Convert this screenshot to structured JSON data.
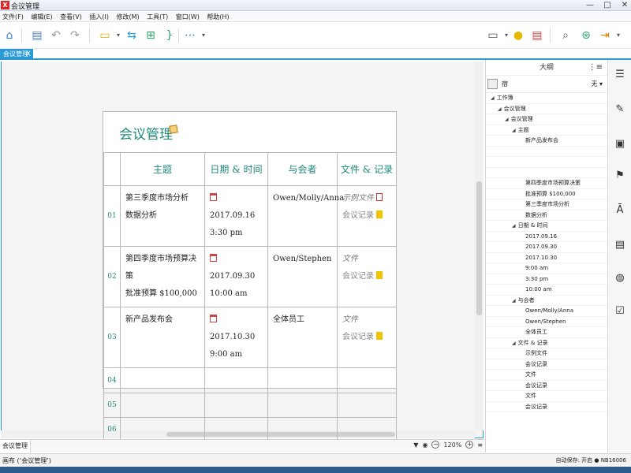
{
  "window": {
    "title": "会议管理",
    "app_icon": "x-logo",
    "controls": [
      "—",
      "□",
      "✕"
    ]
  },
  "menu": [
    "文件(F)",
    "编辑(E)",
    "查看(V)",
    "插入(I)",
    "修改(M)",
    "工具(T)",
    "窗口(W)",
    "帮助(H)"
  ],
  "document_tab": {
    "label": "会议管理",
    "close": "X"
  },
  "doc": {
    "title": "会议管理",
    "headers": [
      "主题",
      "日期 & 时间",
      "与会者",
      "文件 & 记录"
    ],
    "rows": [
      {
        "num": "01",
        "topic_line1": "第三季度市场分析",
        "topic_line2": "数据分析",
        "date": "2017.09.16",
        "time": "3:30 pm",
        "attendees": "Owen/Molly/Anna",
        "file1": "示例文件",
        "file2": "会议记录"
      },
      {
        "num": "02",
        "topic_line1": "第四季度市场预算决策",
        "topic_line2": "批准预算 $100,000",
        "date": "2017.09.30",
        "time": "10:00 am",
        "attendees": "Owen/Stephen",
        "file1": "文件",
        "file2": "会议记录"
      },
      {
        "num": "03",
        "topic_line1": "新产品发布会",
        "topic_line2": "",
        "date": "2017.10.30",
        "time": "9:00 am",
        "attendees": "全体员工",
        "file1": "文件",
        "file2": "会议记录"
      },
      {
        "num": "04"
      },
      {
        "num": "05"
      },
      {
        "num": "06"
      }
    ]
  },
  "status": {
    "sheet_tab": "会议管理",
    "zoom": "120%"
  },
  "bottom": {
    "left": "画布 (‘会议管理’)",
    "right": "自动保存: 开启 ● NB16006"
  },
  "panel": {
    "title": "大纲",
    "toolbar_label": "宿",
    "select_value": "无",
    "outline": [
      {
        "text": "工作簿",
        "level": 0,
        "toggle": true
      },
      {
        "text": "会议管理",
        "level": 1,
        "toggle": true
      },
      {
        "text": "会议管理",
        "level": 2,
        "toggle": true
      },
      {
        "text": "主题",
        "level": 3,
        "toggle": true
      },
      {
        "text": "新产品发布会",
        "level": 4,
        "toggle": false
      },
      {
        "text": "",
        "level": 4,
        "toggle": false
      },
      {
        "text": "",
        "level": 4,
        "toggle": false
      },
      {
        "text": "",
        "level": 4,
        "toggle": false
      },
      {
        "text": "第四季度市场预算决策",
        "level": 4,
        "toggle": false
      },
      {
        "text": "批准预算 $100,000",
        "level": 4,
        "toggle": false
      },
      {
        "text": "第三季度市场分析",
        "level": 4,
        "toggle": false
      },
      {
        "text": "数据分析",
        "level": 4,
        "toggle": false
      },
      {
        "text": "日期 & 时间",
        "level": 3,
        "toggle": true
      },
      {
        "text": "2017.09.16",
        "level": 4,
        "toggle": false
      },
      {
        "text": "2017.09.30",
        "level": 4,
        "toggle": false
      },
      {
        "text": "2017.10.30",
        "level": 4,
        "toggle": false
      },
      {
        "text": "9:00 am",
        "level": 4,
        "toggle": false
      },
      {
        "text": "3:30 pm",
        "level": 4,
        "toggle": false
      },
      {
        "text": "10:00 am",
        "level": 4,
        "toggle": false
      },
      {
        "text": "与会者",
        "level": 3,
        "toggle": true
      },
      {
        "text": "Owen/Molly/Anna",
        "level": 4,
        "toggle": false
      },
      {
        "text": "Owen/Stephen",
        "level": 4,
        "toggle": false
      },
      {
        "text": "全体员工",
        "level": 4,
        "toggle": false
      },
      {
        "text": "文件 & 记录",
        "level": 3,
        "toggle": true
      },
      {
        "text": "示例文件",
        "level": 4,
        "toggle": false
      },
      {
        "text": "会议记录",
        "level": 4,
        "toggle": false
      },
      {
        "text": "文件",
        "level": 4,
        "toggle": false
      },
      {
        "text": "会议记录",
        "level": 4,
        "toggle": false
      },
      {
        "text": "文件",
        "level": 4,
        "toggle": false
      },
      {
        "text": "会议记录",
        "level": 4,
        "toggle": false
      }
    ]
  },
  "colors": {
    "accent": "#2a9ad6",
    "teal": "#1f8a7a"
  }
}
